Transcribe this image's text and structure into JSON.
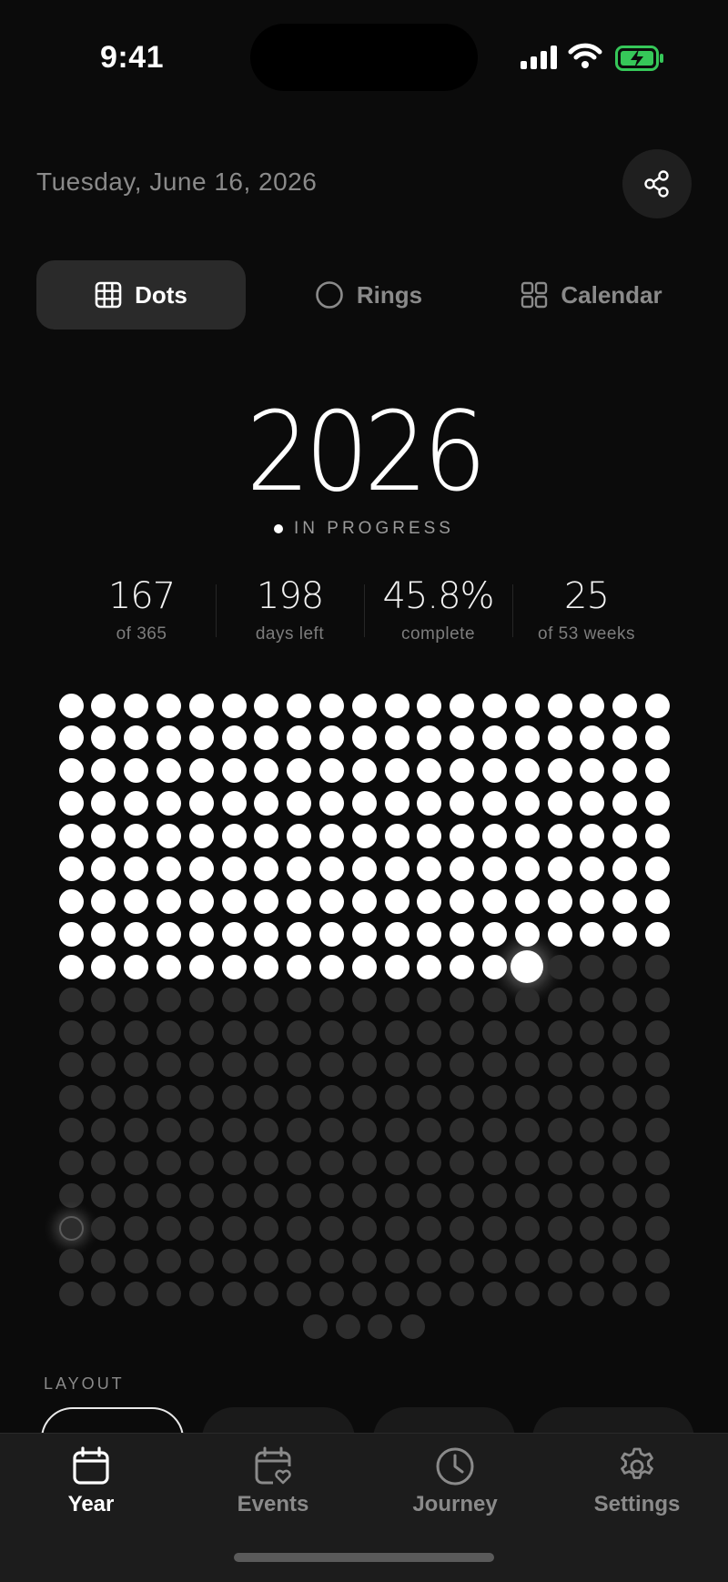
{
  "status_bar": {
    "time": "9:41"
  },
  "header": {
    "date": "Tuesday, June 16, 2026",
    "share_icon": "share-icon"
  },
  "view_tabs": [
    {
      "label": "Dots",
      "icon": "grid-icon",
      "active": true
    },
    {
      "label": "Rings",
      "icon": "ring-icon",
      "active": false
    },
    {
      "label": "Calendar",
      "icon": "calendar-grid-icon",
      "active": false
    }
  ],
  "year": {
    "value": "2026",
    "status": "IN PROGRESS"
  },
  "stats": [
    {
      "value": "167",
      "label": "of 365"
    },
    {
      "value": "198",
      "label": "days left"
    },
    {
      "value": "45.8%",
      "label": "complete"
    },
    {
      "value": "25",
      "label": "of 53 weeks"
    }
  ],
  "dots_grid": {
    "total_days": 365,
    "days_elapsed": 166,
    "today_index": 166,
    "marker_index": 304,
    "columns": 19
  },
  "layout": {
    "label": "LAYOUT"
  },
  "tab_bar": [
    {
      "label": "Year",
      "icon": "calendar-icon",
      "active": true
    },
    {
      "label": "Events",
      "icon": "calendar-heart-icon",
      "active": false
    },
    {
      "label": "Journey",
      "icon": "clock-icon",
      "active": false
    },
    {
      "label": "Settings",
      "icon": "gear-icon",
      "active": false
    }
  ],
  "colors": {
    "background": "#0b0b0b",
    "dot_filled": "#ffffff",
    "dot_empty": "#2d2d2d",
    "muted_text": "#8a8a8a"
  }
}
